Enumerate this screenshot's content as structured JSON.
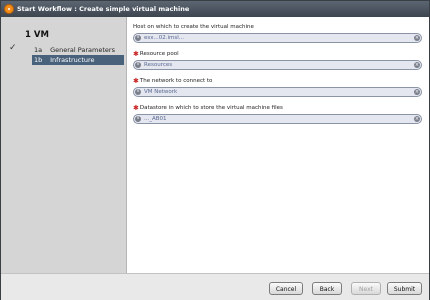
{
  "window": {
    "title": "Start Workflow : Create simple virtual machine"
  },
  "steps": {
    "title": "1  VM",
    "items": [
      {
        "num": "1a",
        "label": "General Parameters",
        "done": true
      },
      {
        "num": "1b",
        "label": "Infrastructure",
        "selected": true
      }
    ]
  },
  "form": {
    "fields": [
      {
        "label": "Host on which to create the virtual machine",
        "required": false,
        "value": "esx...02.imsl...",
        "info_icon": "info-icon",
        "clear_icon": "clear-icon"
      },
      {
        "label": "Resource pool",
        "required": true,
        "value": "Resources",
        "info_icon": "info-icon",
        "clear_icon": "clear-icon"
      },
      {
        "label": "The network to connect to",
        "required": true,
        "value": "VM Network",
        "info_icon": "info-icon",
        "clear_icon": "clear-icon"
      },
      {
        "label": "Datastore in which to store the virtual machine files",
        "required": true,
        "value": "..._AB01",
        "info_icon": "info-icon",
        "clear_icon": "clear-icon"
      }
    ]
  },
  "footer": {
    "cancel": "Cancel",
    "back": "Back",
    "next": "Next",
    "submit": "Submit"
  },
  "colors": {
    "selection": "#49627b",
    "required": "#c81e1e",
    "field_bg": "#e4e6f0"
  }
}
